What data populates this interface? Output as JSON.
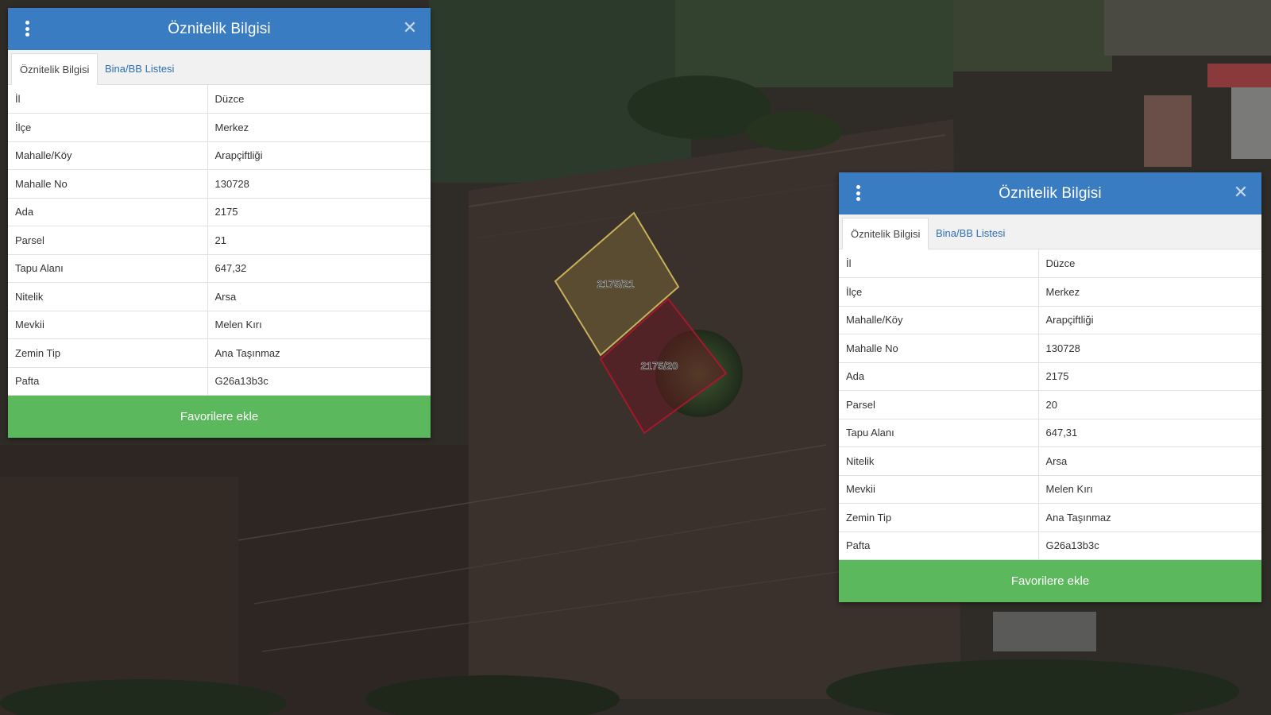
{
  "map": {
    "parcels": [
      {
        "label": "2175/21",
        "stroke": "#c9b15a"
      },
      {
        "label": "2175/20",
        "stroke": "#a3192b"
      }
    ]
  },
  "panels": [
    {
      "title": "Öznitelik Bilgisi",
      "tabs": [
        {
          "label": "Öznitelik Bilgisi",
          "active": true
        },
        {
          "label": "Bina/BB Listesi",
          "active": false
        }
      ],
      "rows": [
        {
          "key": "İl",
          "value": "Düzce"
        },
        {
          "key": "İlçe",
          "value": "Merkez"
        },
        {
          "key": "Mahalle/Köy",
          "value": "Arapçiftliği"
        },
        {
          "key": "Mahalle No",
          "value": "130728"
        },
        {
          "key": "Ada",
          "value": "2175"
        },
        {
          "key": "Parsel",
          "value": "21"
        },
        {
          "key": "Tapu Alanı",
          "value": "647,32"
        },
        {
          "key": "Nitelik",
          "value": "Arsa"
        },
        {
          "key": "Mevkii",
          "value": "Melen Kırı"
        },
        {
          "key": "Zemin Tip",
          "value": "Ana Taşınmaz"
        },
        {
          "key": "Pafta",
          "value": "G26a13b3c"
        }
      ],
      "button": "Favorilere ekle"
    },
    {
      "title": "Öznitelik Bilgisi",
      "tabs": [
        {
          "label": "Öznitelik Bilgisi",
          "active": true
        },
        {
          "label": "Bina/BB Listesi",
          "active": false
        }
      ],
      "rows": [
        {
          "key": "İl",
          "value": "Düzce"
        },
        {
          "key": "İlçe",
          "value": "Merkez"
        },
        {
          "key": "Mahalle/Köy",
          "value": "Arapçiftliği"
        },
        {
          "key": "Mahalle No",
          "value": "130728"
        },
        {
          "key": "Ada",
          "value": "2175"
        },
        {
          "key": "Parsel",
          "value": "20"
        },
        {
          "key": "Tapu Alanı",
          "value": "647,31"
        },
        {
          "key": "Nitelik",
          "value": "Arsa"
        },
        {
          "key": "Mevkii",
          "value": "Melen Kırı"
        },
        {
          "key": "Zemin Tip",
          "value": "Ana Taşınmaz"
        },
        {
          "key": "Pafta",
          "value": "G26a13b3c"
        }
      ],
      "button": "Favorilere ekle"
    }
  ],
  "colors": {
    "header": "#3a7cc2",
    "button": "#5cb85c",
    "tab_link": "#2f6fb4"
  }
}
